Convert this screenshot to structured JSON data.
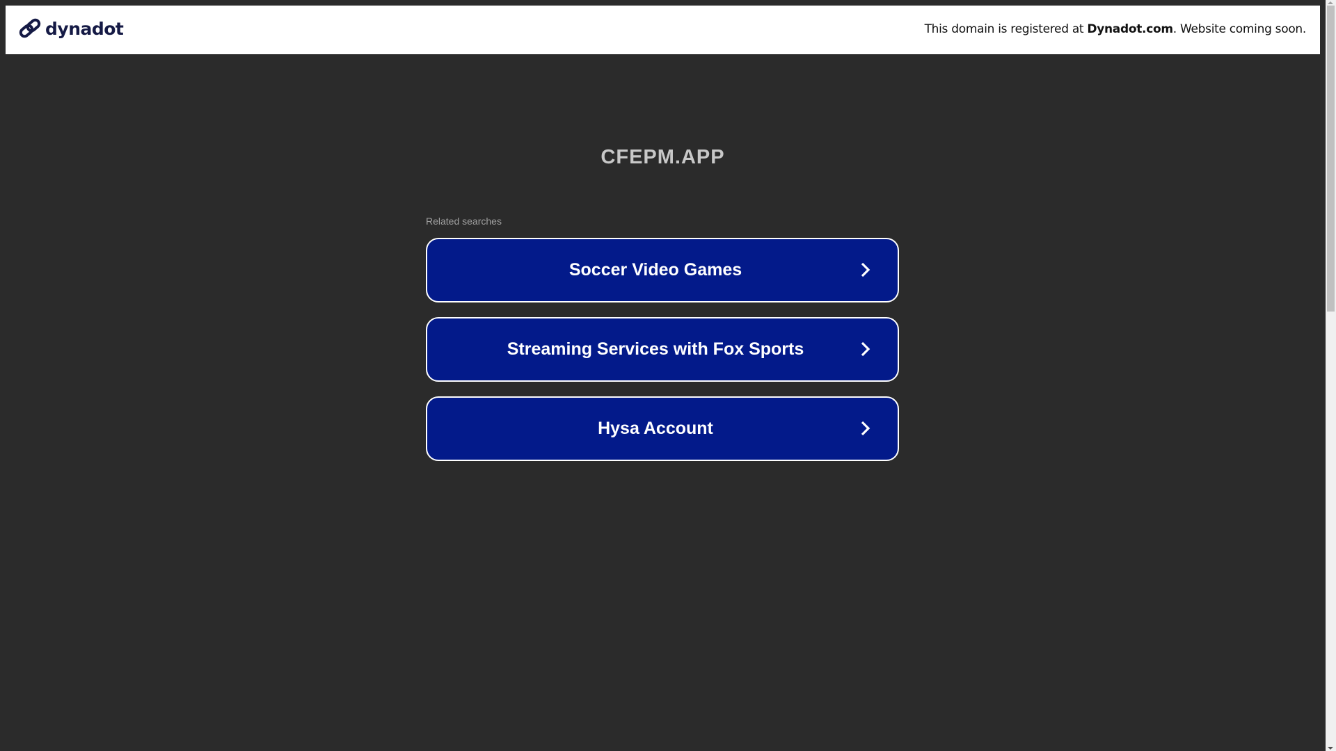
{
  "header": {
    "logo_text": "dynadot",
    "notice_prefix": "This domain is registered at ",
    "notice_brand": "Dynadot.com",
    "notice_suffix": ". Website coming soon."
  },
  "main": {
    "domain_title": "CFEPM.APP",
    "related_label": "Related searches",
    "links": [
      {
        "label": "Soccer Video Games"
      },
      {
        "label": "Streaming Services with Fox Sports"
      },
      {
        "label": "Hysa Account"
      }
    ]
  },
  "colors": {
    "button_bg": "#031a8a",
    "page_bg": "#2b2b2b",
    "logo": "#151a45"
  }
}
